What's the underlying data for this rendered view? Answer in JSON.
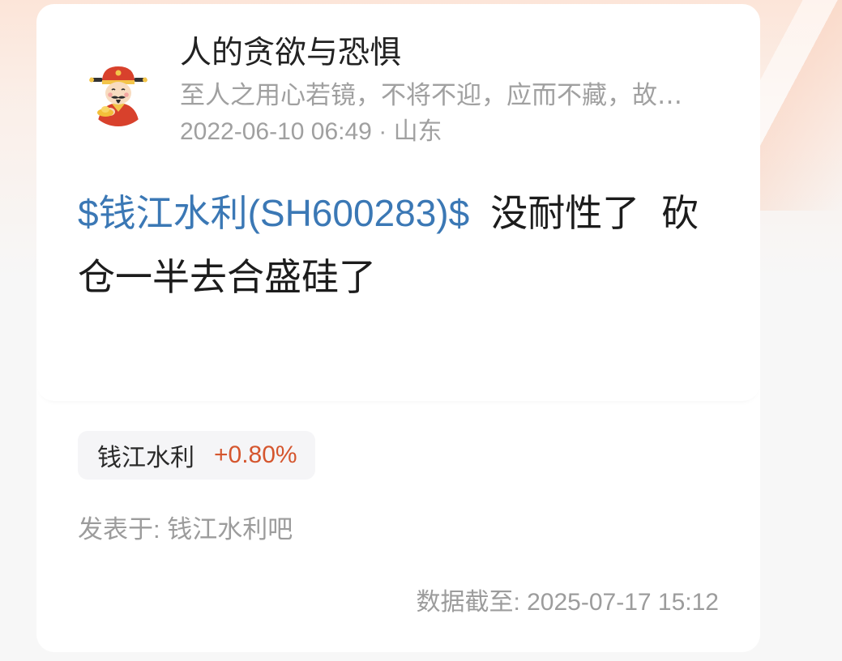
{
  "user": {
    "name": "人的贪欲与恐惧",
    "bio": "至人之用心若镜，不将不迎，应而不藏，故…",
    "timestamp": "2022-06-10 06:49",
    "separator": "·",
    "location": "山东",
    "avatar_icon": "caishen-avatar-icon"
  },
  "post": {
    "stock_tag": "$钱江水利(SH600283)$",
    "text": "没耐性了 砍仓一半去合盛硅了"
  },
  "stock_chip": {
    "name": "钱江水利",
    "change": "+0.80%"
  },
  "forum": {
    "label": "发表于: ",
    "name": "钱江水利吧"
  },
  "data_as_of": "数据截至: 2025-07-17 15:12",
  "colors": {
    "link": "#3b78b5",
    "rise": "#d5562e",
    "text_primary": "#222222",
    "text_secondary": "#a0a0a0"
  }
}
